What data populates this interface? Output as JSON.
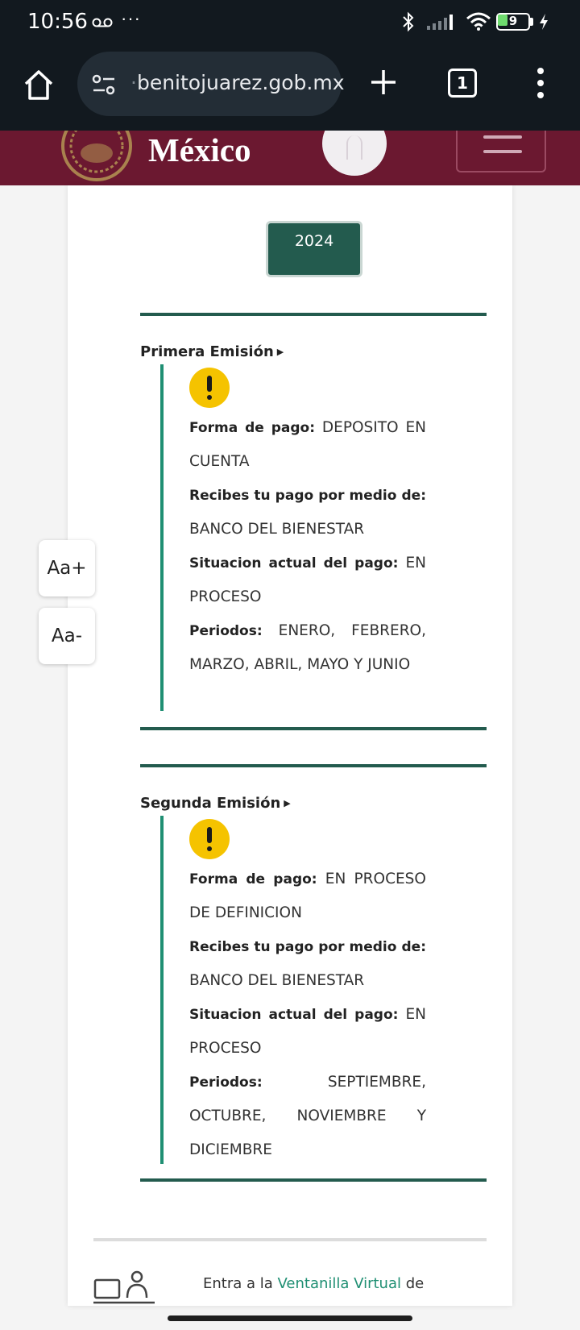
{
  "status_bar": {
    "time": "10:56",
    "dots": "···",
    "battery": "9"
  },
  "browser": {
    "url_faded": "·",
    "url": "benitojuarez.gob.mx",
    "tab_count": "1"
  },
  "header": {
    "title": "México"
  },
  "year_button": "2024",
  "sections": [
    {
      "title": "Primera Emisión",
      "forma_label": "Forma de pago:",
      "forma_value": "DEPOSITO EN CUENTA",
      "recibes_label": "Recibes tu pago por medio de:",
      "recibes_value": "BANCO DEL BIENESTAR",
      "situacion_label": "Situacion actual del pago:",
      "situacion_value": "EN PROCESO",
      "periodos_label": "Periodos:",
      "periodos_value": "ENERO, FEBRERO, MARZO, ABRIL, MAYO Y JUNIO"
    },
    {
      "title": "Segunda Emisión",
      "forma_label": "Forma de pago:",
      "forma_value": "EN PROCESO DE DEFINICION",
      "recibes_label": "Recibes tu pago por medio de:",
      "recibes_value": "BANCO DEL BIENESTAR",
      "situacion_label": "Situacion actual del pago:",
      "situacion_value": "EN PROCESO",
      "periodos_label": "Periodos:",
      "periodos_value": "SEPTIEMBRE, OCTUBRE, NOVIEMBRE Y DICIEMBRE"
    }
  ],
  "font_controls": {
    "increase": "Aa+",
    "decrease": "Aa-"
  },
  "footer": {
    "prefix": "Entra a la",
    "link": "Ventanilla Virtual",
    "suffix": "de"
  },
  "colors": {
    "header": "#6b1830",
    "green": "#235b4e",
    "accent": "#1f8f73",
    "warning": "#f5c300"
  }
}
